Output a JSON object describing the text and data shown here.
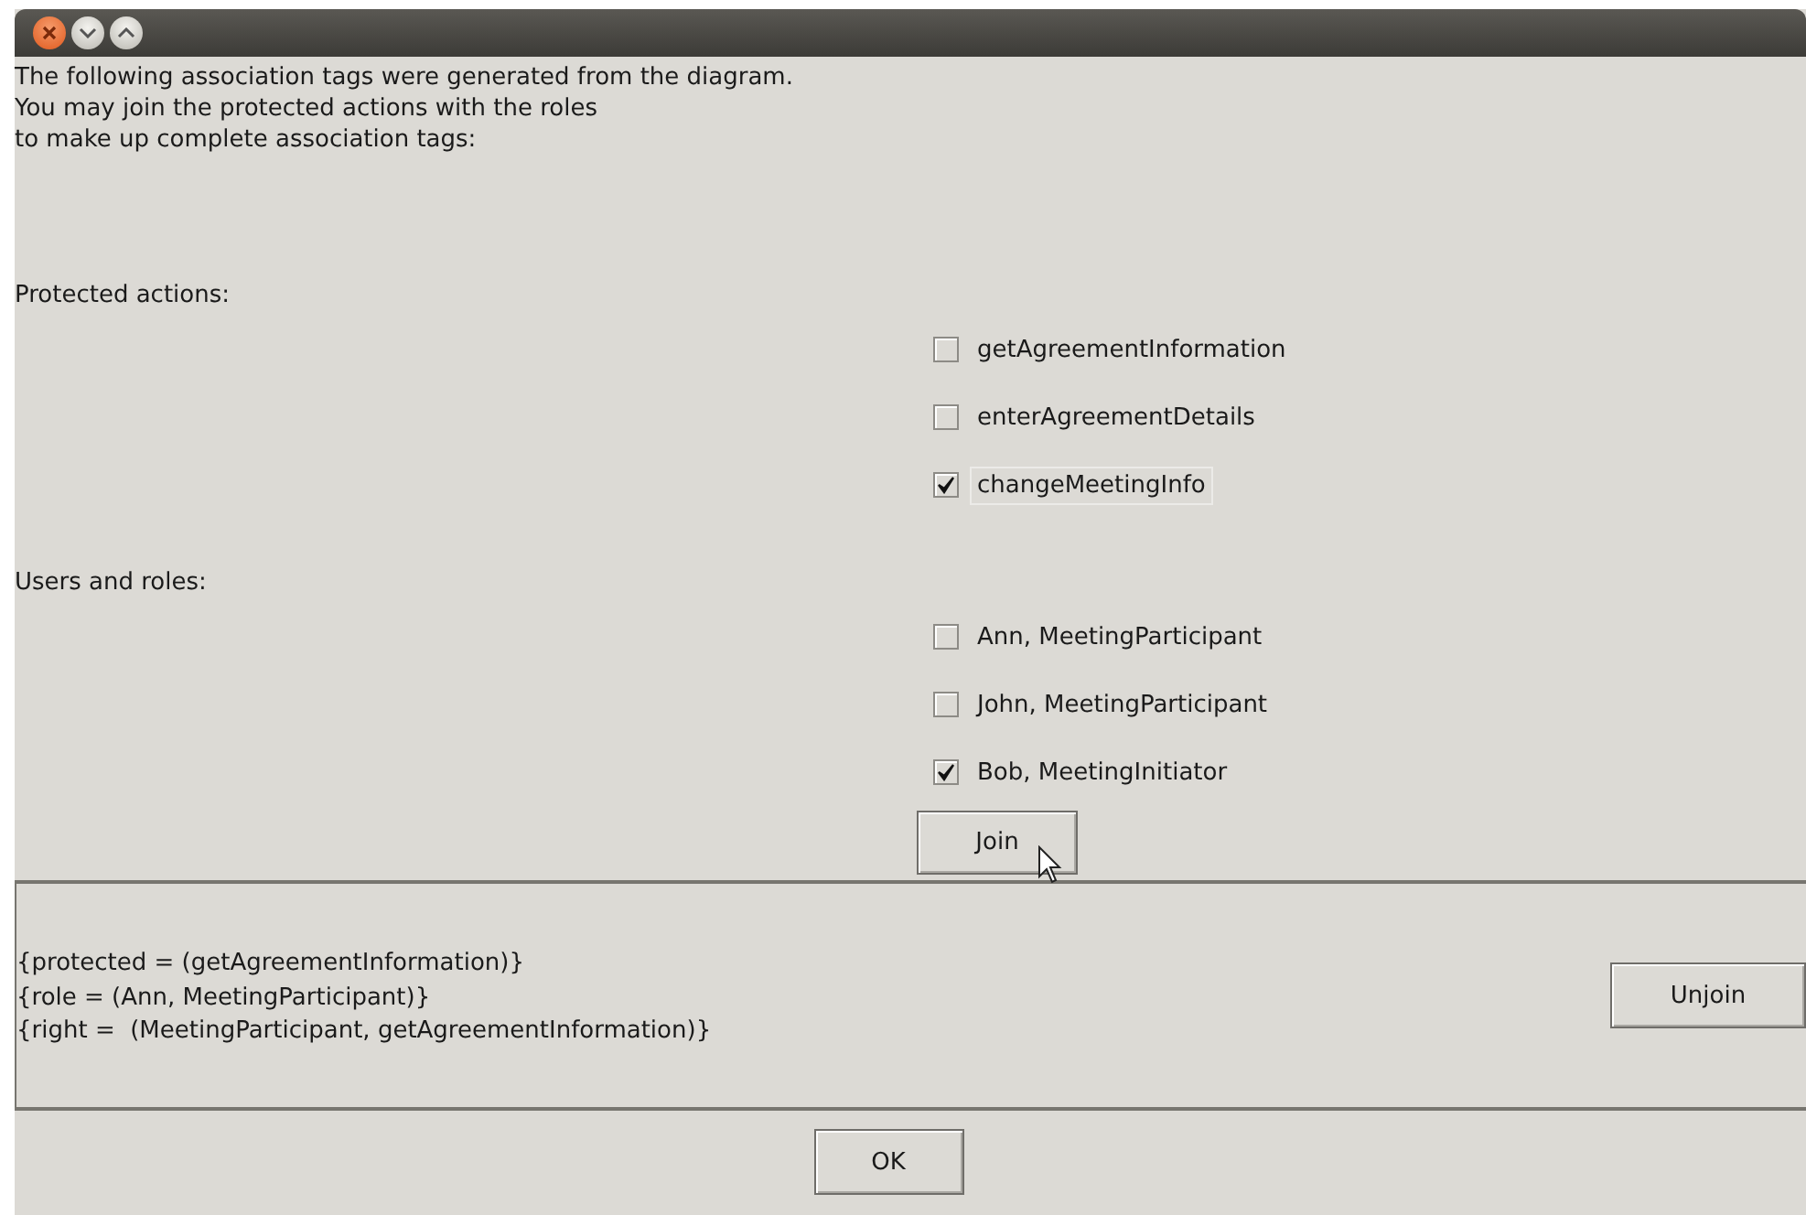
{
  "intro": [
    "The following association tags were generated from the diagram.",
    "You may join the protected actions with the roles",
    "to make up complete association tags:"
  ],
  "protected_actions": {
    "label": "Protected actions:",
    "items": [
      {
        "label": "getAgreementInformation",
        "checked": false,
        "focused": false
      },
      {
        "label": "enterAgreementDetails",
        "checked": false,
        "focused": false
      },
      {
        "label": "changeMeetingInfo",
        "checked": true,
        "focused": true
      }
    ]
  },
  "users_and_roles": {
    "label": "Users and roles:",
    "items": [
      {
        "label": "Ann, MeetingParticipant",
        "checked": false
      },
      {
        "label": "John, MeetingParticipant",
        "checked": false
      },
      {
        "label": "Bob, MeetingInitiator",
        "checked": true
      }
    ]
  },
  "join_button": "Join",
  "result_lines": [
    "{protected = (getAgreementInformation)}",
    "{role = (Ann, MeetingParticipant)}",
    "{right =  (MeetingParticipant, getAgreementInformation)}"
  ],
  "unjoin_button": "Unjoin",
  "ok_button": "OK"
}
